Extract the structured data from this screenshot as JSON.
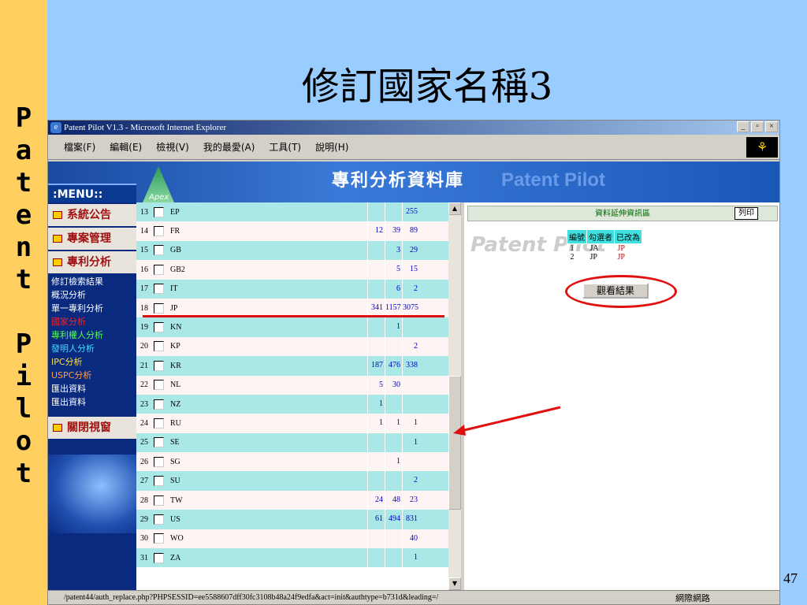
{
  "sidebar": {
    "letters": [
      "P",
      "a",
      "t",
      "e",
      "n",
      "t",
      "",
      "P",
      "i",
      "l",
      "o",
      "t"
    ]
  },
  "slide": {
    "title": "修訂國家名稱3",
    "page": "47"
  },
  "window": {
    "title": "Patent Pilot V1.3 - Microsoft Internet Explorer",
    "btn_min": "_",
    "btn_max": "▫",
    "btn_close": "×"
  },
  "menu": [
    "檔案(F)",
    "編輯(E)",
    "檢視(V)",
    "我的最愛(A)",
    "工具(T)",
    "說明(H)"
  ],
  "banner": {
    "menu": ":MENU::",
    "apex": "Apex",
    "cn": "專利分析資料庫",
    "en": "Patent Pilot"
  },
  "nav": {
    "big": [
      "系統公告",
      "專案管理",
      "專利分析"
    ],
    "small": [
      {
        "t": "修訂檢索結果",
        "c": ""
      },
      {
        "t": "概況分析",
        "c": ""
      },
      {
        "t": "單一專利分析",
        "c": ""
      },
      {
        "t": "國家分析",
        "c": "red"
      },
      {
        "t": "專利權人分析",
        "c": "green"
      },
      {
        "t": "發明人分析",
        "c": "cyan"
      },
      {
        "t": "IPC分析",
        "c": "yellow"
      },
      {
        "t": "USPC分析",
        "c": "orange"
      },
      {
        "t": "匯出資料",
        "c": ""
      },
      {
        "t": "匯出資料",
        "c": ""
      }
    ],
    "close": "關閉視窗"
  },
  "rows": [
    {
      "i": "13",
      "c": "EP",
      "a": "",
      "b": "",
      "d": "255"
    },
    {
      "i": "14",
      "c": "FR",
      "a": "12",
      "b": "39",
      "d": "89"
    },
    {
      "i": "15",
      "c": "GB",
      "a": "",
      "b": "3",
      "d": "29"
    },
    {
      "i": "16",
      "c": "GB2",
      "a": "",
      "b": "5",
      "d": "15"
    },
    {
      "i": "17",
      "c": "IT",
      "a": "",
      "b": "6",
      "d": "2"
    },
    {
      "i": "18",
      "c": "JP",
      "a": "341",
      "b": "1157",
      "d": "3075"
    },
    {
      "i": "19",
      "c": "KN",
      "a": "",
      "b": "1",
      "d": ""
    },
    {
      "i": "20",
      "c": "KP",
      "a": "",
      "b": "",
      "d": "2"
    },
    {
      "i": "21",
      "c": "KR",
      "a": "187",
      "b": "476",
      "d": "338"
    },
    {
      "i": "22",
      "c": "NL",
      "a": "5",
      "b": "30",
      "d": ""
    },
    {
      "i": "23",
      "c": "NZ",
      "a": "1",
      "b": "",
      "d": ""
    },
    {
      "i": "24",
      "c": "RU",
      "a": "1",
      "b": "1",
      "d": "1"
    },
    {
      "i": "25",
      "c": "SE",
      "a": "",
      "b": "",
      "d": "1"
    },
    {
      "i": "26",
      "c": "SG",
      "a": "",
      "b": "1",
      "d": ""
    },
    {
      "i": "27",
      "c": "SU",
      "a": "",
      "b": "",
      "d": "2"
    },
    {
      "i": "28",
      "c": "TW",
      "a": "24",
      "b": "48",
      "d": "23"
    },
    {
      "i": "29",
      "c": "US",
      "a": "61",
      "b": "494",
      "d": "831"
    },
    {
      "i": "30",
      "c": "WO",
      "a": "",
      "b": "",
      "d": "40"
    },
    {
      "i": "31",
      "c": "ZA",
      "a": "",
      "b": "",
      "d": "1"
    }
  ],
  "right": {
    "header": "資料延伸資訊區",
    "print": "列印",
    "bg": "Patent Pilot",
    "cols": [
      "編號",
      "勾選者",
      "已改為"
    ],
    "rows": [
      [
        "1",
        "JA",
        "JP"
      ],
      [
        "2",
        "JP",
        "JP"
      ]
    ],
    "view_btn": "觀看結果"
  },
  "status": {
    "url": "/patent44/auth_replace.php?PHPSESSID=ee5588607dff30fc3108b48a24f9edfa&act=init&authtype=b731d&leading=/",
    "zone": "網際網路"
  },
  "colors": {
    "accent_red": "#e01010",
    "row_cyan": "#aae8e8"
  }
}
